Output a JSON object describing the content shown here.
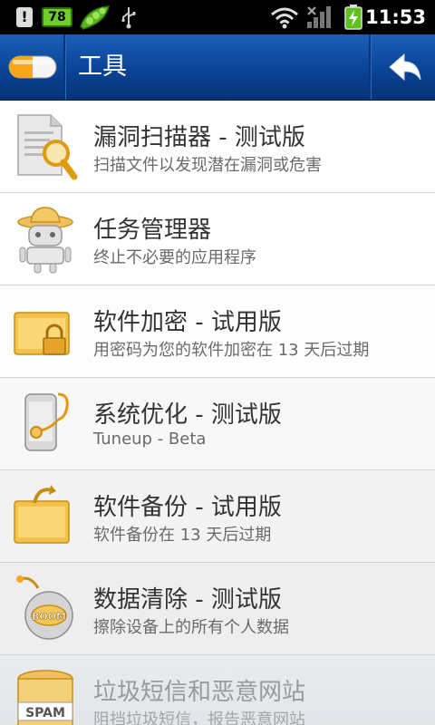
{
  "status_bar": {
    "battery_badge": "78",
    "alert_glyph": "!",
    "time": "11:53",
    "icons": [
      "alert-icon",
      "battery-app-icon",
      "pea-pod-icon",
      "usb-icon",
      "wifi-icon",
      "signal-icon",
      "battery-charging-icon"
    ]
  },
  "header": {
    "title": "工具",
    "icons": [
      "pill-logo-icon",
      "back-arrow-icon"
    ]
  },
  "items": [
    {
      "title": "漏洞扫描器 - 测试版",
      "subtitle": "扫描文件以发现潜在漏洞或危害",
      "icon": "document-magnifier-icon"
    },
    {
      "title": "任务管理器",
      "subtitle": "终止不必要的应用程序",
      "icon": "robot-hat-icon"
    },
    {
      "title": "软件加密 - 试用版",
      "subtitle": "用密码为您的软件加密在 13 天后过期",
      "icon": "folder-lock-icon"
    },
    {
      "title": "系统优化 - 测试版",
      "subtitle": "Tuneup - Beta",
      "icon": "phone-stethoscope-icon"
    },
    {
      "title": "软件备份 - 试用版",
      "subtitle": "软件备份在 13 天后过期",
      "icon": "folder-backup-icon"
    },
    {
      "title": "数据清除 - 测试版",
      "subtitle": "擦除设备上的所有个人数据",
      "icon": "boom-bomb-icon",
      "icon_text": "BOOM"
    },
    {
      "title": "垃圾短信和恶意网站",
      "subtitle": "阻挡垃圾短信，报告恶意网站",
      "icon": "spam-can-icon",
      "icon_text": "SPAM"
    }
  ]
}
